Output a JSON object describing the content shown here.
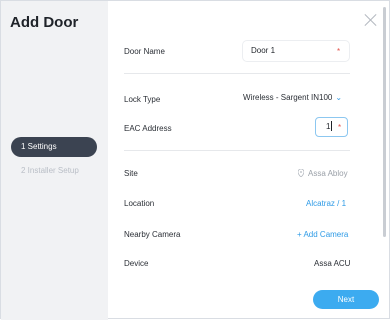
{
  "dialog": {
    "title": "Add Door"
  },
  "steps": [
    {
      "label": "1 Settings"
    },
    {
      "label": "2 Installer Setup"
    }
  ],
  "form": {
    "door_name": {
      "label": "Door Name",
      "value": "Door 1",
      "required_mark": "*"
    },
    "lock_type": {
      "label": "Lock Type",
      "value": "Wireless - Sargent IN100"
    },
    "eac_address": {
      "label": "EAC Address",
      "value": "1",
      "required_mark": "*"
    },
    "site": {
      "label": "Site",
      "value": "Assa Abloy"
    },
    "location": {
      "label": "Location",
      "value": "Alcatraz / 1"
    },
    "nearby_camera": {
      "label": "Nearby Camera",
      "action": "+ Add Camera"
    },
    "device": {
      "label": "Device",
      "value": "Assa ACU"
    }
  },
  "actions": {
    "next_label": "Next"
  },
  "colors": {
    "accent": "#3cabf0",
    "link": "#2f9be6",
    "required": "#e4524a",
    "sidebar_bg": "#f1f2f4",
    "active_step_bg": "#3b4351"
  },
  "icons": {
    "close": "close-icon",
    "chevron": "chevron-down-icon",
    "site": "map-pin-icon"
  }
}
